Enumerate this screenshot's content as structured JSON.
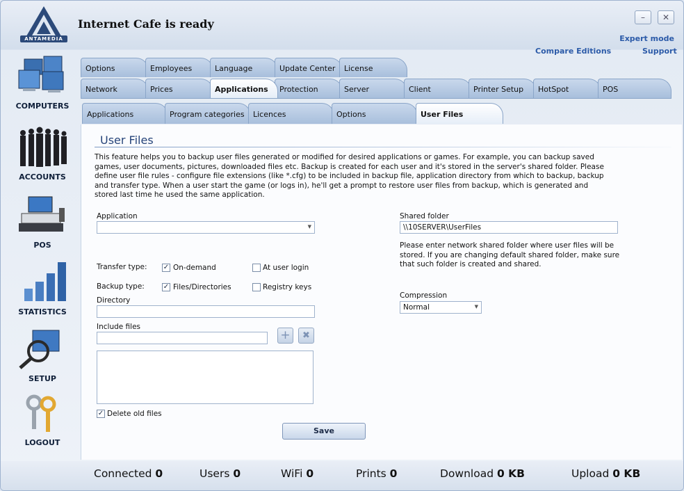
{
  "header": {
    "title": "Internet Cafe is ready",
    "logo_text": "ANTAMEDIA",
    "expert_mode": "Expert mode",
    "compare_editions": "Compare Editions",
    "support": "Support",
    "minimize_glyph": "–",
    "close_glyph": "✕"
  },
  "sidebar": {
    "items": [
      {
        "label": "COMPUTERS",
        "icon": "computers-icon"
      },
      {
        "label": "ACCOUNTS",
        "icon": "accounts-icon"
      },
      {
        "label": "POS",
        "icon": "pos-icon"
      },
      {
        "label": "STATISTICS",
        "icon": "statistics-icon"
      },
      {
        "label": "SETUP",
        "icon": "setup-icon"
      },
      {
        "label": "LOGOUT",
        "icon": "logout-icon"
      }
    ]
  },
  "tabs": {
    "row1": [
      "Options",
      "Employees",
      "Language",
      "Update Center",
      "License"
    ],
    "row2": [
      "Network",
      "Prices",
      "Applications",
      "Protection",
      "Server",
      "Client",
      "Printer Setup",
      "HotSpot",
      "POS"
    ],
    "row2_active": "Applications",
    "subtabs": [
      "Applications",
      "Program categories",
      "Licences",
      "Options",
      "User Files"
    ],
    "subtab_active": "User Files"
  },
  "main": {
    "section_title": "User Files",
    "description": "This feature helps you to backup user files generated or modified for desired applications or games. For example, you can backup saved games, user documents, pictures, downloaded files etc. Backup is created for each user and it's stored in the server's shared folder. Please define user file rules - configure file extensions (like *.cfg) to be included in backup file, application directory from which to backup, backup and transfer type. When a user start the game (or logs in), he'll get a prompt to restore user files from backup, which is generated and stored last time he used the same application.",
    "application_label": "Application",
    "application_value": "",
    "transfer_type_label": "Transfer type:",
    "on_demand_label": "On-demand",
    "on_demand_checked": true,
    "at_user_login_label": "At user login",
    "at_user_login_checked": false,
    "backup_type_label": "Backup type:",
    "files_dirs_label": "Files/Directories",
    "files_dirs_checked": true,
    "registry_keys_label": "Registry keys",
    "registry_keys_checked": false,
    "directory_label": "Directory",
    "directory_value": "",
    "include_files_label": "Include files",
    "include_files_value": "",
    "add_glyph": "+",
    "remove_glyph": "✖",
    "delete_old_files_label": "Delete old files",
    "delete_old_files_checked": true,
    "shared_folder_label": "Shared folder",
    "shared_folder_value": "\\\\10SERVER\\UserFiles",
    "shared_folder_note": "Please enter network shared folder where user files will be stored. If you are changing default shared folder, make sure that such folder is created and shared.",
    "compression_label": "Compression",
    "compression_value": "Normal",
    "save_label": "Save"
  },
  "statusbar": {
    "connected_label": "Connected",
    "connected_value": "0",
    "users_label": "Users",
    "users_value": "0",
    "wifi_label": "WiFi",
    "wifi_value": "0",
    "prints_label": "Prints",
    "prints_value": "0",
    "download_label": "Download",
    "download_value": "0 KB",
    "upload_label": "Upload",
    "upload_value": "0 KB"
  },
  "colors": {
    "accent": "#2b5aa8",
    "title": "#27457a",
    "tab": "#a8bfdc"
  }
}
